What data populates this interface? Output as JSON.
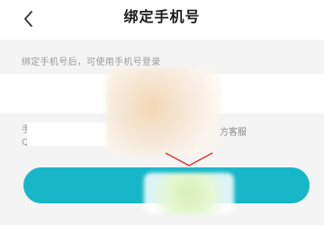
{
  "header": {
    "title": "绑定手机号"
  },
  "hint": {
    "text": "绑定手机号后，可使用手机号登录"
  },
  "phone": {
    "value": ""
  },
  "note": {
    "line1_left": "手",
    "line2_left": "Q",
    "right_text": "方客服"
  },
  "submit": {
    "label": ""
  },
  "colors": {
    "accent": "#17b7c8",
    "background": "#f4f4f4",
    "hint_text": "#9b9b9b",
    "chevron": "#e0302a"
  },
  "icons": {
    "back": "chevron-left-icon",
    "pointer": "chevron-down-icon"
  }
}
